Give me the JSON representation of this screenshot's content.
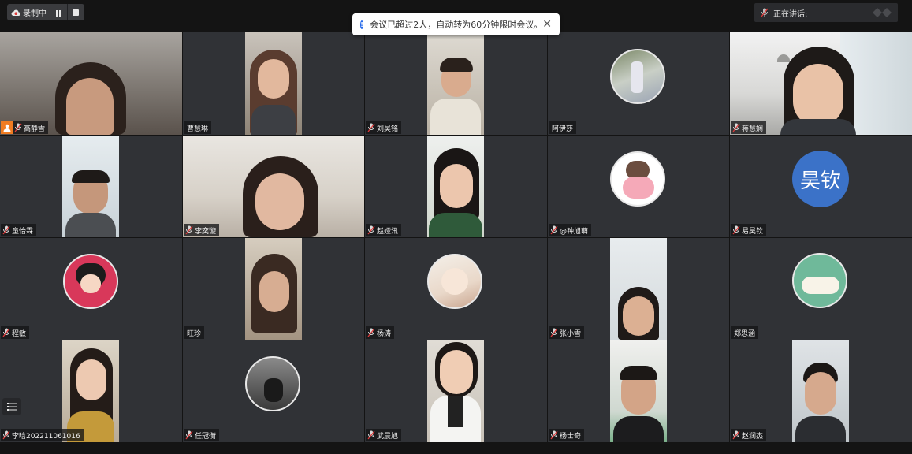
{
  "toolbar": {
    "record_label": "录制中",
    "notice_text": "会议已超过2人，自动转为60分钟限时会议。",
    "speaking_label": "正在讲话:"
  },
  "colors": {
    "accent": "#2569ea",
    "host_badge": "#f07c22",
    "tile_bg": "#303236"
  },
  "participants": [
    {
      "name": "高静雪",
      "muted": true,
      "host": true
    },
    {
      "name": "曹慧琳",
      "muted": false
    },
    {
      "name": "刘昊铭",
      "muted": true
    },
    {
      "name": "阿伊莎",
      "muted": false
    },
    {
      "name": "蒋慧娴",
      "muted": true
    },
    {
      "name": "童怡霖",
      "muted": true
    },
    {
      "name": "李奕璇",
      "muted": true
    },
    {
      "name": "赵娅汛",
      "muted": true
    },
    {
      "name": "@钟旭萌",
      "muted": true
    },
    {
      "name": "易昊钦",
      "muted": true,
      "avatar_text": "昊钦"
    },
    {
      "name": "程敏",
      "muted": true
    },
    {
      "name": "旺珍",
      "muted": false
    },
    {
      "name": "杨涛",
      "muted": true
    },
    {
      "name": "张小雪",
      "muted": true
    },
    {
      "name": "郑思涵",
      "muted": false
    },
    {
      "name": "李晗202211061016",
      "muted": true
    },
    {
      "name": "任冠衡",
      "muted": true
    },
    {
      "name": "武晨旭",
      "muted": true
    },
    {
      "name": "杨士奇",
      "muted": true
    },
    {
      "name": "赵润杰",
      "muted": true
    }
  ]
}
